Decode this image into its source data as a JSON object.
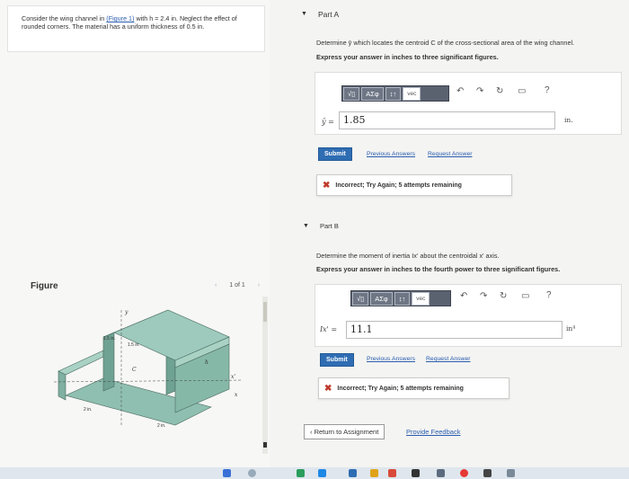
{
  "problem": {
    "text_before": "Consider the wing channel in ",
    "link": "(Figure 1)",
    "text_after": " with h = 2.4 in. Neglect the effect of rounded corners. The material has a uniform thickness of 0.5 in."
  },
  "figure": {
    "label": "Figure",
    "pager": {
      "prev": "‹",
      "current": "1 of 1",
      "next": "›"
    },
    "dims": {
      "t1": "1.5 in.",
      "t2": "1.5 in.",
      "w1": "2 in.",
      "w2": "2 in.",
      "x_axis": "x",
      "y_axis": "y",
      "x2": "x'",
      "h": "h",
      "c": "C"
    }
  },
  "partA": {
    "title": "Part A",
    "instruction": "Determine ȳ which locates the centroid C of the cross-sectional area of the wing channel.",
    "express": "Express your answer in inches to three significant figures.",
    "toolbar": [
      "√▯",
      "ΑΣφ",
      "↕↑",
      "vec"
    ],
    "tools": [
      "↶",
      "↷",
      "↻",
      "▭",
      "?"
    ],
    "variable": "ȳ =",
    "value": "1.85",
    "unit": "in.",
    "submit": "Submit",
    "prev_answers": "Previous Answers",
    "request_answer": "Request Answer",
    "feedback": "Incorrect; Try Again; 5 attempts remaining"
  },
  "partB": {
    "title": "Part B",
    "instruction": "Determine the moment of inertia Ix' about the centroidal x' axis.",
    "express": "Express your answer in inches to the fourth power to three significant figures.",
    "toolbar": [
      "√▯",
      "ΑΣφ",
      "↕↑",
      "vec"
    ],
    "tools": [
      "↶",
      "↷",
      "↻",
      "▭",
      "?"
    ],
    "variable": "Ix' =",
    "value": "11.1",
    "unit": "in⁴",
    "submit": "Submit",
    "prev_answers": "Previous Answers",
    "request_answer": "Request Answer",
    "feedback": "Incorrect; Try Again; 5 attempts remaining"
  },
  "footer": {
    "return": "‹ Return to Assignment",
    "provide_feedback": "Provide Feedback"
  },
  "colors": {
    "submit": "#2f6db3",
    "toolbar": "#5a6270",
    "model": "#8fbfb0",
    "error": "#c0392b"
  }
}
